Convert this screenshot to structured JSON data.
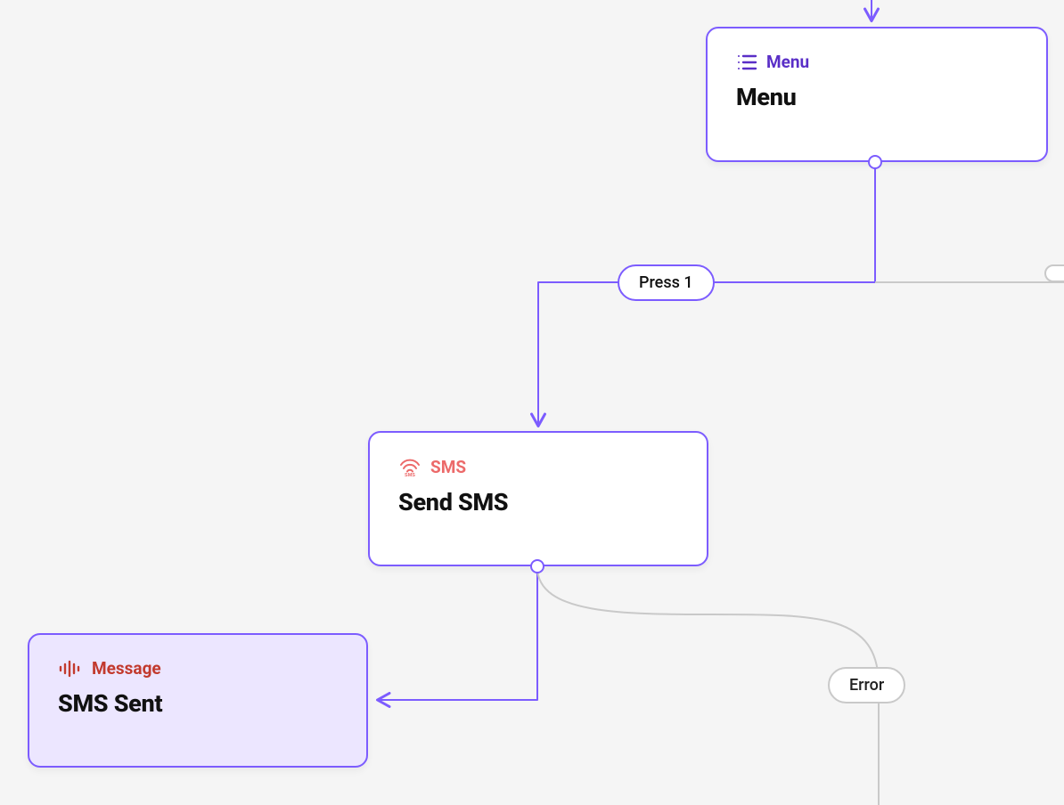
{
  "nodes": {
    "menu": {
      "type_label": "Menu",
      "title": "Menu"
    },
    "sms": {
      "type_label": "SMS",
      "title": "Send SMS"
    },
    "smsSent": {
      "type_label": "Message",
      "title": "SMS Sent"
    }
  },
  "pills": {
    "press1": "Press 1",
    "error": "Error"
  },
  "colors": {
    "edge_purple": "#7c5cff",
    "edge_gray": "#c9c9c9",
    "menu_accent": "#5a2fc7",
    "sms_accent": "#ec6a6a",
    "msg_accent": "#c23a2e"
  }
}
